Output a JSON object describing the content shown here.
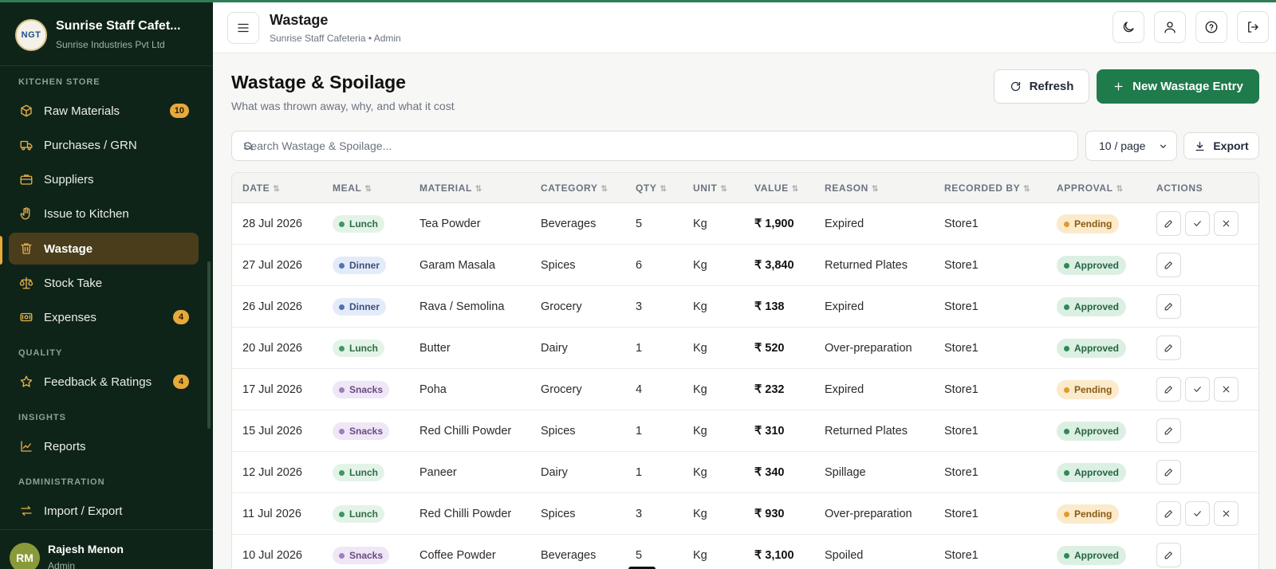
{
  "brand": {
    "logo_text": "NGT",
    "name": "Sunrise Staff Cafet...",
    "company": "Sunrise Industries Pvt Ltd"
  },
  "sidebar": {
    "sections": [
      {
        "label": "KITCHEN STORE"
      },
      {
        "label": "QUALITY"
      },
      {
        "label": "INSIGHTS"
      },
      {
        "label": "ADMINISTRATION"
      }
    ],
    "items": [
      {
        "label": "Raw Materials",
        "icon": "box-icon",
        "badge": "10"
      },
      {
        "label": "Purchases / GRN",
        "icon": "truck-icon",
        "badge": ""
      },
      {
        "label": "Suppliers",
        "icon": "briefcase-icon",
        "badge": ""
      },
      {
        "label": "Issue to Kitchen",
        "icon": "hand-icon",
        "badge": ""
      },
      {
        "label": "Wastage",
        "icon": "trash-icon",
        "badge": "",
        "active": true
      },
      {
        "label": "Stock Take",
        "icon": "scale-icon",
        "badge": ""
      },
      {
        "label": "Expenses",
        "icon": "wallet-icon",
        "badge": "4"
      },
      {
        "label": "Feedback & Ratings",
        "icon": "star-icon",
        "badge": "4"
      },
      {
        "label": "Reports",
        "icon": "chart-icon",
        "badge": ""
      },
      {
        "label": "Import / Export",
        "icon": "transfer-icon",
        "badge": ""
      }
    ]
  },
  "user": {
    "initials": "RM",
    "name": "Rajesh Menon",
    "role": "Admin"
  },
  "header": {
    "title": "Wastage",
    "subtitle": "Sunrise Staff Cafeteria • Admin"
  },
  "main": {
    "title": "Wastage & Spoilage",
    "subtitle": "What was thrown away, why, and what it cost",
    "refresh_label": "Refresh",
    "new_label": "New Wastage Entry",
    "search_placeholder": "Search Wastage & Spoilage...",
    "per_page": "10 / page",
    "export_label": "Export"
  },
  "table": {
    "columns": [
      "DATE",
      "MEAL",
      "MATERIAL",
      "CATEGORY",
      "QTY",
      "UNIT",
      "VALUE",
      "REASON",
      "RECORDED BY",
      "APPROVAL",
      "ACTIONS"
    ],
    "rows": [
      {
        "date": "28 Jul 2026",
        "meal": "Lunch",
        "material": "Tea Powder",
        "category": "Beverages",
        "qty": "5",
        "unit": "Kg",
        "value": "₹ 1,900",
        "reason": "Expired",
        "recorded_by": "Store1",
        "approval": "Pending"
      },
      {
        "date": "27 Jul 2026",
        "meal": "Dinner",
        "material": "Garam Masala",
        "category": "Spices",
        "qty": "6",
        "unit": "Kg",
        "value": "₹ 3,840",
        "reason": "Returned Plates",
        "recorded_by": "Store1",
        "approval": "Approved"
      },
      {
        "date": "26 Jul 2026",
        "meal": "Dinner",
        "material": "Rava / Semolina",
        "category": "Grocery",
        "qty": "3",
        "unit": "Kg",
        "value": "₹ 138",
        "reason": "Expired",
        "recorded_by": "Store1",
        "approval": "Approved"
      },
      {
        "date": "20 Jul 2026",
        "meal": "Lunch",
        "material": "Butter",
        "category": "Dairy",
        "qty": "1",
        "unit": "Kg",
        "value": "₹ 520",
        "reason": "Over-preparation",
        "recorded_by": "Store1",
        "approval": "Approved"
      },
      {
        "date": "17 Jul 2026",
        "meal": "Snacks",
        "material": "Poha",
        "category": "Grocery",
        "qty": "4",
        "unit": "Kg",
        "value": "₹ 232",
        "reason": "Expired",
        "recorded_by": "Store1",
        "approval": "Pending"
      },
      {
        "date": "15 Jul 2026",
        "meal": "Snacks",
        "material": "Red Chilli Powder",
        "category": "Spices",
        "qty": "1",
        "unit": "Kg",
        "value": "₹ 310",
        "reason": "Returned Plates",
        "recorded_by": "Store1",
        "approval": "Approved"
      },
      {
        "date": "12 Jul 2026",
        "meal": "Lunch",
        "material": "Paneer",
        "category": "Dairy",
        "qty": "1",
        "unit": "Kg",
        "value": "₹ 340",
        "reason": "Spillage",
        "recorded_by": "Store1",
        "approval": "Approved"
      },
      {
        "date": "11 Jul 2026",
        "meal": "Lunch",
        "material": "Red Chilli Powder",
        "category": "Spices",
        "qty": "3",
        "unit": "Kg",
        "value": "₹ 930",
        "reason": "Over-preparation",
        "recorded_by": "Store1",
        "approval": "Pending"
      },
      {
        "date": "10 Jul 2026",
        "meal": "Snacks",
        "material": "Coffee Powder",
        "category": "Beverages",
        "qty": "5",
        "unit": "Kg",
        "value": "₹ 3,100",
        "reason": "Spoiled",
        "recorded_by": "Store1",
        "approval": "Approved"
      }
    ]
  },
  "colors": {
    "sidebar_bg": "#0f2418",
    "accent": "#1f7a4c",
    "active_item": "#4a3d1c",
    "badge": "#e7a93a"
  }
}
